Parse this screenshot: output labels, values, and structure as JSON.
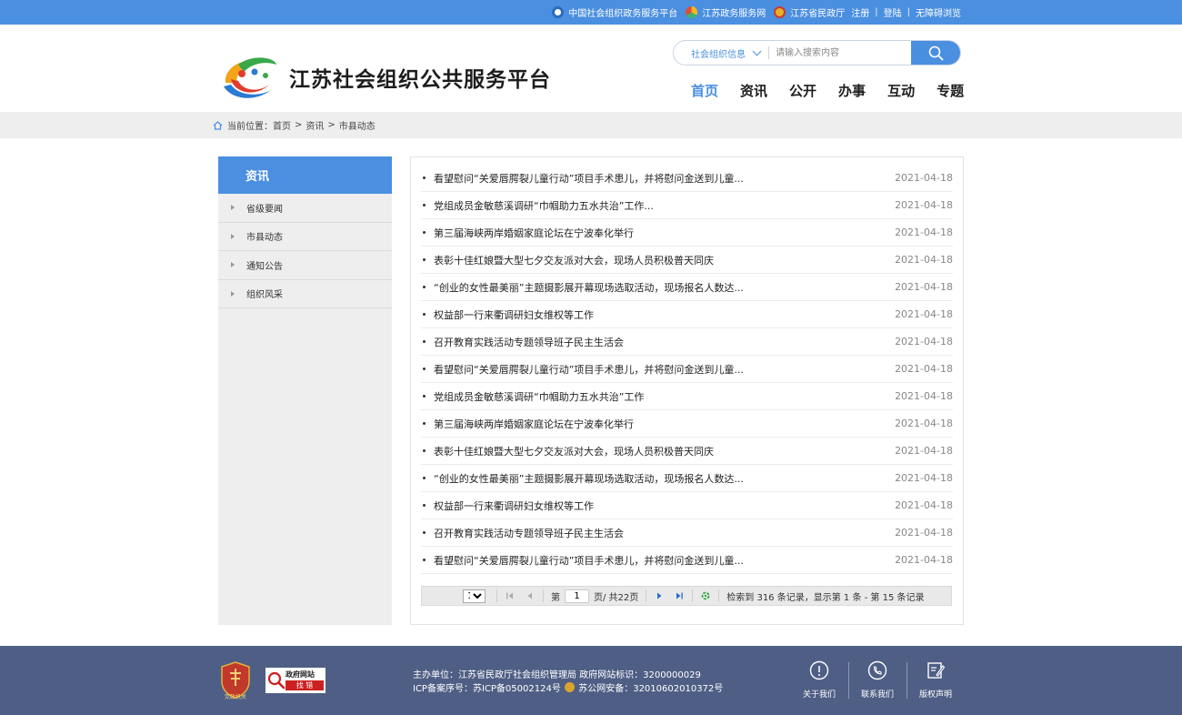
{
  "topbar": {
    "links": [
      "中国社会组织政务服务平台",
      "江苏政务服务网",
      "江苏省民政厅"
    ],
    "register": "注册",
    "login": "登陆",
    "accessible": "无障碍浏览",
    "separator": "|"
  },
  "header": {
    "logo_text": "江苏社会组织公共服务平台",
    "search_category": "社会组织信息",
    "search_placeholder": "请输入搜索内容",
    "nav": [
      "首页",
      "资讯",
      "公开",
      "办事",
      "互动",
      "专题"
    ],
    "active_nav": "首页"
  },
  "breadcrumb": {
    "label": "当前位置：",
    "items": [
      "首页",
      "资讯",
      "市县动态"
    ],
    "separator": ">"
  },
  "sidebar": {
    "heading": "资讯",
    "items": [
      "省级要闻",
      "市县动态",
      "通知公告",
      "组织风采"
    ]
  },
  "list": [
    {
      "title": "看望慰问“关爱唇腭裂儿童行动”项目手术患儿，并将慰问金送到儿童...",
      "date": "2021-04-18"
    },
    {
      "title": "党组成员金敏慈溪调研“巾帼助力五水共治”工作...",
      "date": "2021-04-18"
    },
    {
      "title": "第三届海峡两岸婚姻家庭论坛在宁波奉化举行",
      "date": "2021-04-18"
    },
    {
      "title": "表彰十佳红娘暨大型七夕交友派对大会，现场人员积极普天同庆",
      "date": "2021-04-18"
    },
    {
      "title": "“创业的女性最美丽”主题摄影展开幕现场选取活动，现场报名人数达...",
      "date": "2021-04-18"
    },
    {
      "title": "权益部一行来衢调研妇女维权等工作",
      "date": "2021-04-18"
    },
    {
      "title": "召开教育实践活动专题领导班子民主生活会",
      "date": "2021-04-18"
    },
    {
      "title": "看望慰问“关爱唇腭裂儿童行动”项目手术患儿，并将慰问金送到儿童...",
      "date": "2021-04-18"
    },
    {
      "title": "党组成员金敏慈溪调研“巾帼助力五水共治”工作",
      "date": "2021-04-18"
    },
    {
      "title": "第三届海峡两岸婚姻家庭论坛在宁波奉化举行",
      "date": "2021-04-18"
    },
    {
      "title": "表彰十佳红娘暨大型七夕交友派对大会，现场人员积极普天同庆",
      "date": "2021-04-18"
    },
    {
      "title": "“创业的女性最美丽”主题摄影展开幕现场选取活动，现场报名人数达...",
      "date": "2021-04-18"
    },
    {
      "title": "权益部一行来衢调研妇女维权等工作",
      "date": "2021-04-18"
    },
    {
      "title": "召开教育实践活动专题领导班子民主生活会",
      "date": "2021-04-18"
    },
    {
      "title": "看望慰问“关爱唇腭裂儿童行动”项目手术患儿，并将慰问金送到儿童...",
      "date": "2021-04-18"
    }
  ],
  "pager": {
    "page_size": "15",
    "page_prefix": "第",
    "current_page": "1",
    "page_suffix": "页/ 共22页",
    "summary": "检索到 316 条记录，显示第 1 条 - 第 15 条记录"
  },
  "footer": {
    "badge_gov": "党政机关",
    "badge_site_top": "政府网站",
    "badge_site_bottom": "找 错",
    "line1": "主办单位：江苏省民政厅社会组织管理局 政府网站标识：3200000029",
    "icp": "ICP备案序号：苏ICP备05002124号",
    "police": "苏公网安备：32010602010372号",
    "links": [
      "关于我们",
      "联系我们",
      "版权声明"
    ]
  },
  "colors": {
    "primary": "#4a8fe0",
    "footer_bg": "#4f5e85",
    "sidebar_bg": "#eeeeee"
  }
}
